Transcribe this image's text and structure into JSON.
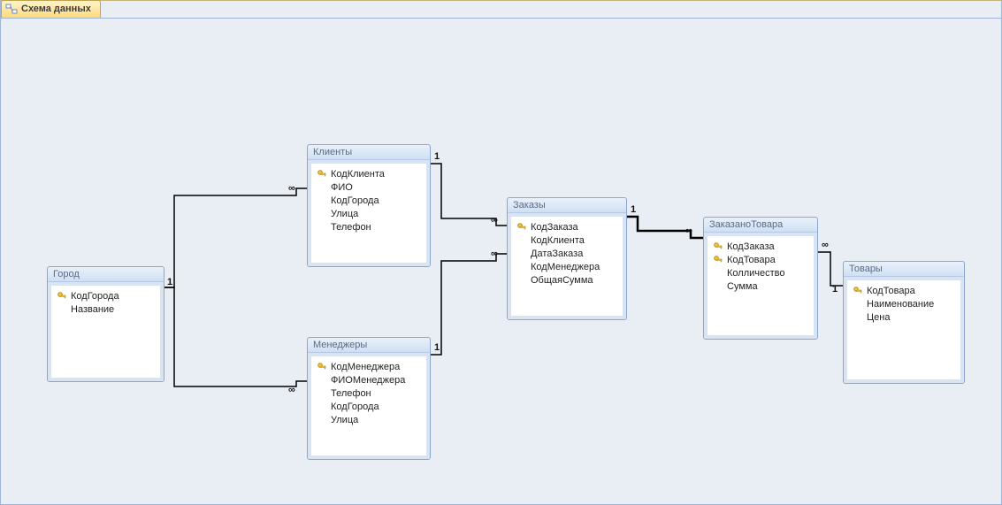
{
  "tab": {
    "title": "Схема данных"
  },
  "relation_marks": {
    "one": "1",
    "many": "∞"
  },
  "tables": {
    "gorod": {
      "title": "Город",
      "fields": [
        {
          "name": "КодГорода",
          "pk": true
        },
        {
          "name": "Название",
          "pk": false
        }
      ]
    },
    "klienty": {
      "title": "Клиенты",
      "fields": [
        {
          "name": "КодКлиента",
          "pk": true
        },
        {
          "name": "ФИО",
          "pk": false
        },
        {
          "name": "КодГорода",
          "pk": false
        },
        {
          "name": "Улица",
          "pk": false
        },
        {
          "name": "Телефон",
          "pk": false
        }
      ]
    },
    "menedzhery": {
      "title": "Менеджеры",
      "fields": [
        {
          "name": "КодМенеджера",
          "pk": true
        },
        {
          "name": "ФИОМенеджера",
          "pk": false
        },
        {
          "name": "Телефон",
          "pk": false
        },
        {
          "name": "КодГорода",
          "pk": false
        },
        {
          "name": "Улица",
          "pk": false
        }
      ]
    },
    "zakazy": {
      "title": "Заказы",
      "fields": [
        {
          "name": "КодЗаказа",
          "pk": true
        },
        {
          "name": "КодКлиента",
          "pk": false
        },
        {
          "name": "ДатаЗаказа",
          "pk": false
        },
        {
          "name": "КодМенеджера",
          "pk": false
        },
        {
          "name": "ОбщаяСумма",
          "pk": false
        }
      ]
    },
    "zakazanotovara": {
      "title": "ЗаказаноТовара",
      "fields": [
        {
          "name": "КодЗаказа",
          "pk": true
        },
        {
          "name": "КодТовара",
          "pk": true
        },
        {
          "name": "Колличество",
          "pk": false
        },
        {
          "name": "Сумма",
          "pk": false
        }
      ]
    },
    "tovary": {
      "title": "Товары",
      "fields": [
        {
          "name": "КодТовара",
          "pk": true
        },
        {
          "name": "Наименование",
          "pk": false
        },
        {
          "name": "Цена",
          "pk": false
        }
      ]
    }
  },
  "relationships": [
    {
      "from": "gorod",
      "from_mark": "one",
      "to": "klienty",
      "to_mark": "many"
    },
    {
      "from": "gorod",
      "from_mark": "one",
      "to": "menedzhery",
      "to_mark": "many"
    },
    {
      "from": "klienty",
      "from_mark": "one",
      "to": "zakazy",
      "to_mark": "many"
    },
    {
      "from": "menedzhery",
      "from_mark": "one",
      "to": "zakazy",
      "to_mark": "many"
    },
    {
      "from": "zakazy",
      "from_mark": "one",
      "to": "zakazanotovara",
      "to_mark": "many"
    },
    {
      "from": "tovary",
      "from_mark": "one",
      "to": "zakazanotovara",
      "to_mark": "many"
    }
  ]
}
